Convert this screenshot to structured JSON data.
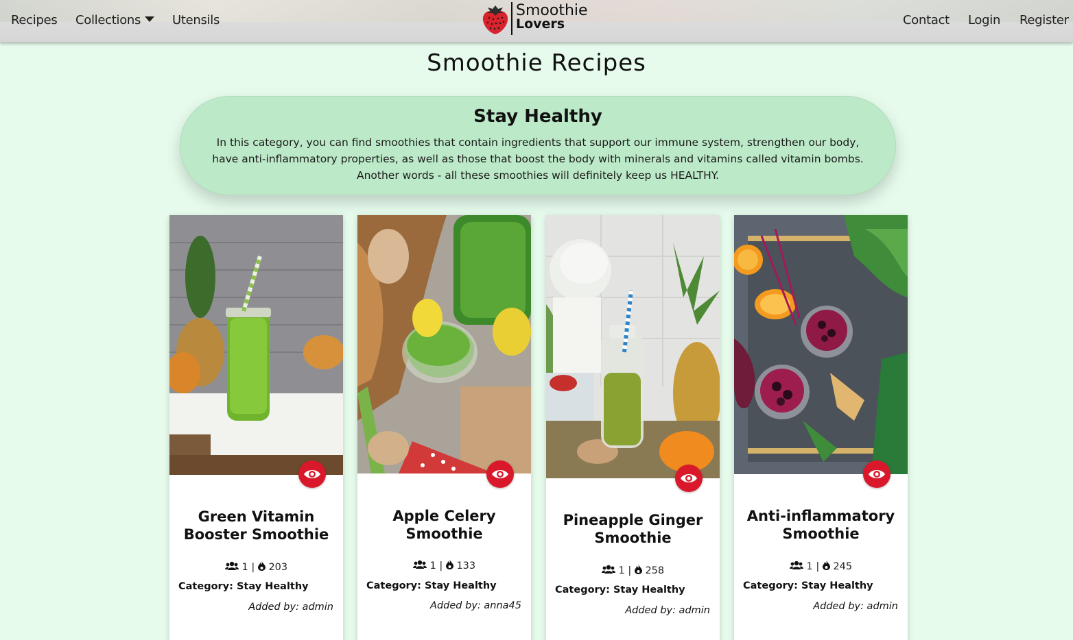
{
  "nav": {
    "recipes": "Recipes",
    "collections": "Collections",
    "utensils": "Utensils",
    "contact": "Contact",
    "login": "Login",
    "register": "Register"
  },
  "logo": {
    "line1": "Smoothie",
    "line2": "Lovers",
    "icon": "strawberry-icon"
  },
  "page_title": "Smoothie Recipes",
  "category": {
    "title": "Stay Healthy",
    "description": "In this category, you can find smoothies that contain ingredients that support our immune system, strengthen our body, have anti-inflammatory properties, as well as those that boost the body with minerals and vitamins called vitamin bombs. Another words - all these smoothies will definitely keep us HEALTHY."
  },
  "colors": {
    "page_bg": "#e6fbec",
    "banner_bg": "#bce9c8",
    "accent_red": "#d9192b"
  },
  "recipes": [
    {
      "title": "Green Vitamin Booster Smoothie",
      "servings": "1",
      "calories": "203",
      "category_label": "Category: Stay Healthy",
      "added_by": "Added by: admin",
      "icon": "eye-icon"
    },
    {
      "title": "Apple Celery Smoothie",
      "servings": "1",
      "calories": "133",
      "category_label": "Category: Stay Healthy",
      "added_by": "Added by: anna45",
      "icon": "eye-icon"
    },
    {
      "title": "Pineapple Ginger Smoothie",
      "servings": "1",
      "calories": "258",
      "category_label": "Category: Stay Healthy",
      "added_by": "Added by: admin",
      "icon": "eye-icon"
    },
    {
      "title": "Anti-inflammatory Smoothie",
      "servings": "1",
      "calories": "245",
      "category_label": "Category: Stay Healthy",
      "added_by": "Added by: admin",
      "icon": "eye-icon"
    }
  ]
}
